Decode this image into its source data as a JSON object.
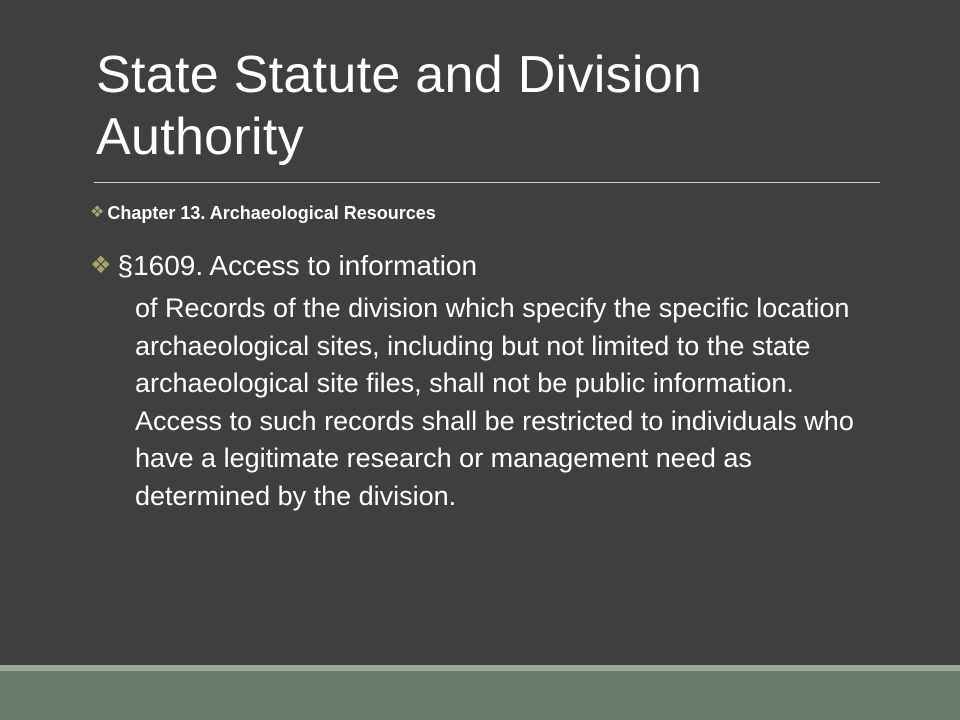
{
  "slide": {
    "title": "State Statute and Division Authority",
    "bullets": [
      {
        "icon": "diamond-bullet-icon",
        "text": "Chapter 13. Archaeological Resources"
      },
      {
        "icon": "diamond-bullet-icon",
        "text": "§1609. Access to information"
      }
    ],
    "body": "of Records of the division which specify the specific location archaeological sites, including but not limited to the state archaeological site files, shall not be public information. Access to such records shall be restricted to individuals who have a legitimate research or management need as determined by the division."
  },
  "colors": {
    "background": "#3f3f3f",
    "accent": "#a8a470",
    "footer": "#6a7a6d",
    "footer_line": "#9aaa9d",
    "text": "#ffffff"
  }
}
